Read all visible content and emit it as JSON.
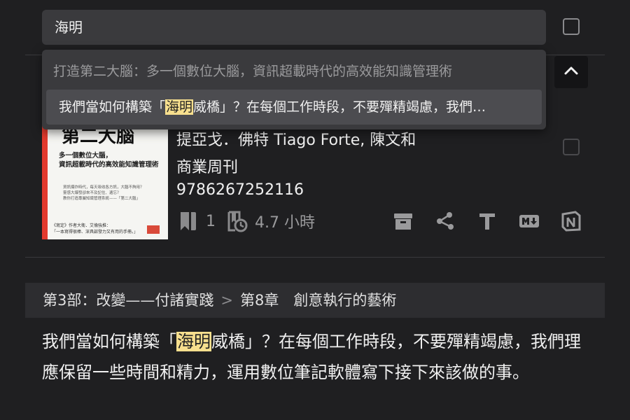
{
  "search": {
    "value": "海明"
  },
  "dropdown": {
    "header": "打造第二大腦：多一個數位大腦，資訊超載時代的高效能知識管理術",
    "item_pre": "我們當如何構築「",
    "item_hl": "海明",
    "item_post": "威橋」？在每個工作時段，不要殫精竭慮，我們…"
  },
  "book": {
    "cover": {
      "title": "第二大腦",
      "subtitle_line1": "多一個數位大腦，",
      "subtitle_line2": "資訊超載時代的高效能知識管理術",
      "small_line1": "資訊爆炸時代，每天吸收各方訊，大腦不夠用？",
      "small_line2": "靈感大爆發卻來不及記住、遺忘？",
      "small_line3": "教你打造專屬知識管理系統——「第二大腦」",
      "blurb_line1": "《寫定》作者大衛．艾倫強推：",
      "blurb_line2": "「一本寫得很棒、深具啟發力又有用的手冊。」"
    },
    "author": "提亞戈．佛特 Tiago Forte, 陳文和",
    "publisher": "商業周刊",
    "isbn": "9786267252116",
    "highlights_count": "1",
    "reading_time": "4.7 小時"
  },
  "icons": {
    "bookmark": "bookmark-icon",
    "reading_time": "book-clock-icon",
    "archive": "archive-icon",
    "share": "share-icon",
    "text": "text-format-icon",
    "markdown": "markdown-icon",
    "notion": "notion-icon",
    "collapse": "chevron-up-icon"
  },
  "location": {
    "part": "第3部：改變——付諸實踐",
    "separator": ">",
    "chapter": "第8章　創意執行的藝術"
  },
  "passage": {
    "pre": "我們當如何構築「",
    "hl": "海明",
    "post": "威橋」？在每個工作時段，不要殫精竭慮，我們理應保留一些時間和精力，運用數位筆記軟體寫下接下來該做的事。"
  },
  "colors": {
    "background": "#1f1f21",
    "highlight": "#f7df8e",
    "surface": "#3a3a3d",
    "muted": "#9a9a9c"
  }
}
